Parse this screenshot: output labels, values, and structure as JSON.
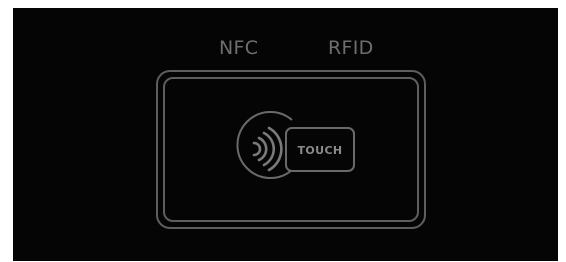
{
  "panel": {
    "nfc_label": "NFC",
    "rfid_label": "RFID",
    "touch_label": "TOUCH",
    "contactless_icon": "contactless-waves-icon"
  },
  "colors": {
    "background": "#050505",
    "outline": "#6a6a6a",
    "text": "#6e6e6e"
  }
}
